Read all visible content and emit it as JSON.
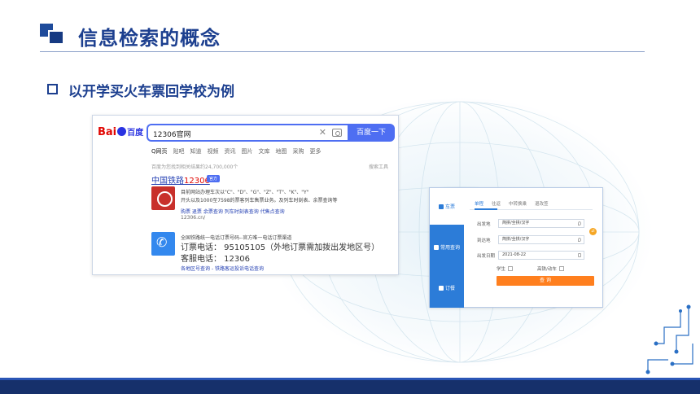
{
  "slide": {
    "title": "信息检索的概念",
    "subtitle": "以开学买火车票回学校为例",
    "colors": {
      "title": "#1c3f8f",
      "bottom_bar": "#16306b"
    }
  },
  "baidu": {
    "logo_text": "Bai",
    "logo_du": "百度",
    "query": "12306官网",
    "clear_icon": "close-icon",
    "camera_icon": "camera-icon",
    "search_button": "百度一下",
    "tabs": [
      "Q网页",
      "贴吧",
      "知道",
      "视频",
      "资讯",
      "图片",
      "文库",
      "地图",
      "采购",
      "更多"
    ],
    "result_count": "百度为您找到相关结果约24,700,000个",
    "tools": "搜索工具",
    "result1": {
      "title_prefix": "中国铁路",
      "title_red": "12306",
      "badge": "官方",
      "line1": "目前网站办理车次以\"C\"、\"D\"、\"G\"、\"Z\"、\"T\"、\"K\"、\"Y\"",
      "line2": "开头以及1000至7598的票客列车售票业务。及列车时刻表、余票查询等",
      "links": "购票  退票  余票查询  列车时刻表查询  代售点查询",
      "url": "12306.cn/"
    },
    "result2": {
      "head": "全国铁路统一电话订票号码--官方唯一电话订票渠道",
      "phone_line": "订票电话：  95105105（外地订票需加拨出发地区号）",
      "service_line": "客服电话：  12306",
      "links": "各地区号查询 - 铁路客运投诉电话查询"
    }
  },
  "ticket": {
    "sidebar": [
      {
        "label": "车票",
        "active": true
      },
      {
        "label": "常用查询",
        "active": false
      },
      {
        "label": "订餐",
        "active": false
      }
    ],
    "tabs": [
      "单程",
      "往返",
      "中转换乘",
      "退改签"
    ],
    "from_label": "出发地",
    "from_value": "简拼/全拼/汉字",
    "to_label": "到达地",
    "to_value": "简拼/全拼/汉字",
    "date_label": "出发日期",
    "date_value": "2021-08-22",
    "swap": "⇄",
    "student_label": "学生",
    "gd_label": "高铁/动车",
    "query_button": "查  询"
  }
}
